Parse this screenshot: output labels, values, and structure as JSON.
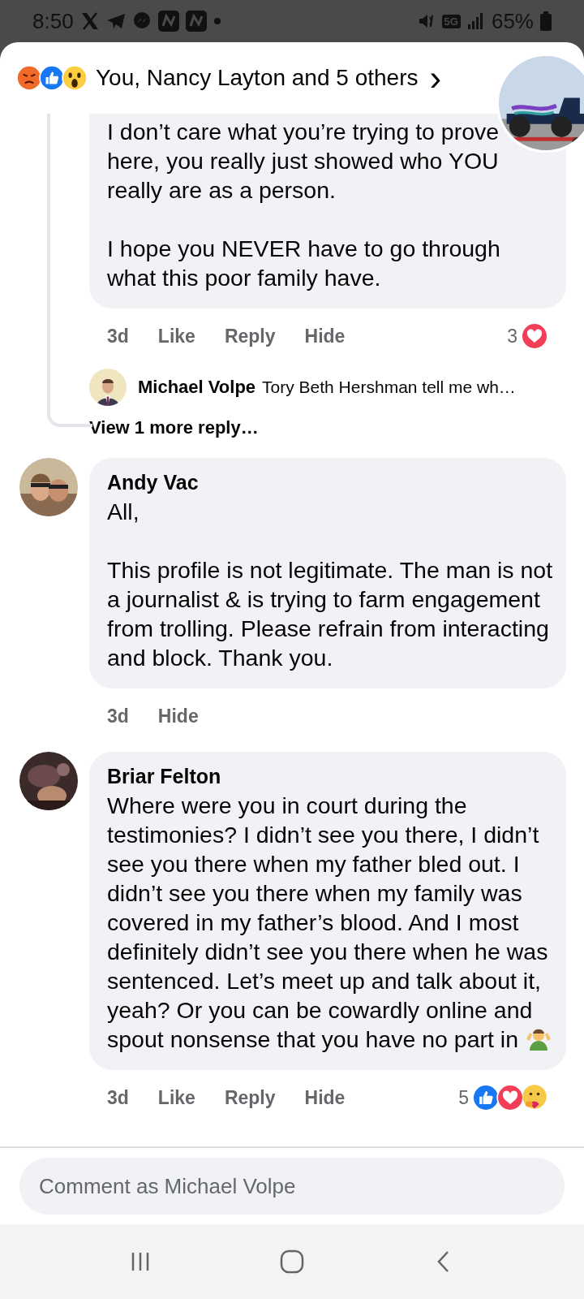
{
  "status_bar": {
    "time": "8:50",
    "network": "5G",
    "battery": "65%"
  },
  "header": {
    "reactions": [
      {
        "kind": "angry"
      },
      {
        "kind": "like"
      },
      {
        "kind": "wow"
      }
    ],
    "title": "You, Nancy Layton and 5 others",
    "chevron": "›"
  },
  "comments": [
    {
      "cut_top": true,
      "paragraphs": [
        "I don’t care what you’re trying to prove here, you really just showed who YOU really are as a person.",
        "I hope you NEVER have to go through what this poor family have."
      ],
      "time": "3d",
      "actions": [
        "Like",
        "Reply",
        "Hide"
      ],
      "reaction_count": "3",
      "reactions": [
        {
          "kind": "love"
        }
      ],
      "replies": [
        {
          "name": "Michael Volpe",
          "text": "Tory Beth Hershman tell me wh…"
        }
      ],
      "more": "View 1 more reply…"
    },
    {
      "cut_top": false,
      "name": "Andy Vac",
      "paragraphs": [
        "All,",
        "This profile is not legitimate. The man is not a journalist & is trying to farm engagement from trolling. Please refrain from interacting and block. Thank you."
      ],
      "time": "3d",
      "actions": [
        "Hide"
      ]
    },
    {
      "cut_top": false,
      "name": "Briar Felton",
      "paragraphs": [
        "Where were you in court during the testimonies? I didn’t see you there, I didn’t see you there when my father bled out. I didn’t see you there when my family was covered in my father’s blood. And I most definitely didn’t see you there when he was sentenced. Let’s meet up and talk about it, yeah? Or you can be cowardly online and spout nonsense that you have no part in"
      ],
      "trailing_icon": {
        "kind": "shrug"
      },
      "time": "3d",
      "actions": [
        "Like",
        "Reply",
        "Hide"
      ],
      "reaction_count": "5",
      "reactions": [
        {
          "kind": "like"
        },
        {
          "kind": "love"
        },
        {
          "kind": "care"
        }
      ]
    }
  ],
  "composer": {
    "placeholder": "Comment as Michael Volpe"
  }
}
